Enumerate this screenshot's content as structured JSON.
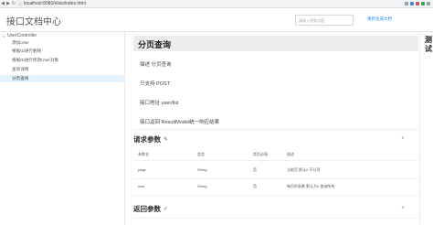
{
  "browser": {
    "url": "localhost:8080/elsis/index.html",
    "nav_back": "◀",
    "nav_forward": "▶",
    "nav_reload": "↻",
    "lock": "ⓘ"
  },
  "header": {
    "app_title": "接口文档中心",
    "search_placeholder": "请输入搜索内容",
    "regen_label": "重新生成文档"
  },
  "sidebar": {
    "group_label": "UserController",
    "group_chevron": "∨",
    "items": [
      {
        "label": "添加User"
      },
      {
        "label": "根据ID进行删除"
      },
      {
        "label": "根据ID进行修改User对象"
      },
      {
        "label": "查询详情"
      },
      {
        "label": "分页查询"
      }
    ],
    "active_index": 4
  },
  "main": {
    "page_title": "分页查询",
    "info": {
      "desc": "描述  分页查询",
      "method": "只支持  POST",
      "address": "接口地址  user/list",
      "returns": "接口返回  ResultModel统一响应结果"
    },
    "request_section": {
      "title": "请求参数",
      "icon": "✎",
      "chevron": "∨",
      "headers": [
        "参数名",
        "类型",
        "是否必填",
        "描述"
      ],
      "rows": [
        [
          "page",
          "String",
          "否",
          "当前页 默认0 不分页"
        ],
        [
          "size",
          "String",
          "否",
          "每页的条数 默认为0 查询所有"
        ]
      ]
    },
    "response_section": {
      "title": "返回参数",
      "icon": "✓",
      "chevron": "∨"
    }
  },
  "right_panel": {
    "title": "测试"
  }
}
